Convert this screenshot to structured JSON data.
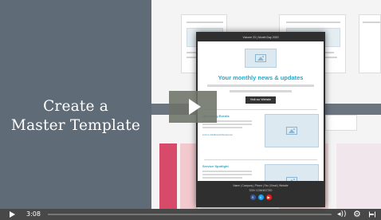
{
  "video": {
    "title_line1": "Create a",
    "title_line2": "Master Template",
    "time": "3:08"
  },
  "email": {
    "top_bar": "Volume 23 | Month Day 2020",
    "headline": "Your monthly news & updates",
    "cta_label": "Visit our Website",
    "section1_title": "Upcoming Events",
    "section1_link": "Link to Additional Resources",
    "section2_title": "Service Spotlight",
    "section2_link": "Link to Additional Resources",
    "footer_links": "Name | Company | Phone | Fax | Email | Website",
    "footer_stay": "STAY CONNECTED",
    "social": [
      "f",
      "t",
      "▶"
    ]
  },
  "colors": {
    "panel": "#5f6b77",
    "accent": "#2aa6c6",
    "facebook": "#3b5998",
    "twitter": "#1da1f2",
    "youtube": "#e62117"
  },
  "icons": {
    "play": "play-icon",
    "volume": "volume-icon",
    "settings": "gear-icon",
    "fullscreen": "fullscreen-icon"
  }
}
